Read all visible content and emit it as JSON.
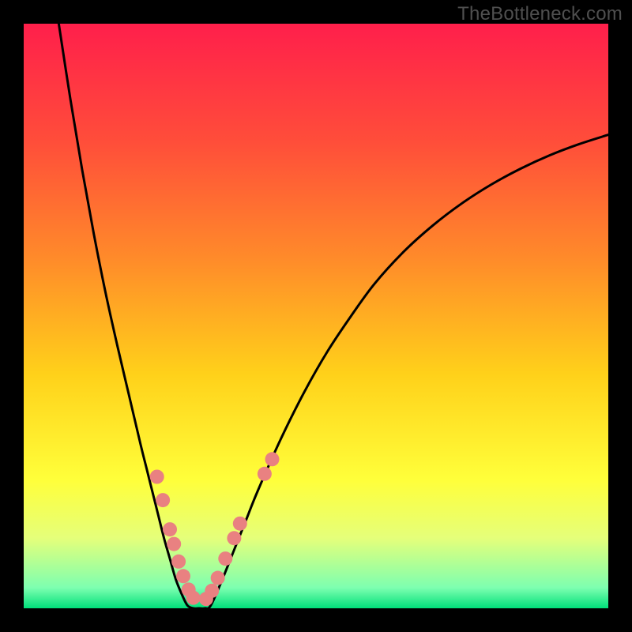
{
  "watermark": "TheBottleneck.com",
  "chart_data": {
    "type": "line",
    "title": "",
    "xlabel": "",
    "ylabel": "",
    "xlim": [
      0,
      100
    ],
    "ylim": [
      0,
      100
    ],
    "grid": false,
    "legend": false,
    "background_gradient_stops": [
      {
        "offset": 0.0,
        "color": "#ff1f4b"
      },
      {
        "offset": 0.2,
        "color": "#ff4d3a"
      },
      {
        "offset": 0.4,
        "color": "#ff8a2a"
      },
      {
        "offset": 0.6,
        "color": "#ffd11a"
      },
      {
        "offset": 0.78,
        "color": "#ffff3a"
      },
      {
        "offset": 0.88,
        "color": "#e5ff7a"
      },
      {
        "offset": 0.965,
        "color": "#7dffb0"
      },
      {
        "offset": 1.0,
        "color": "#00e07a"
      }
    ],
    "series": [
      {
        "name": "left-branch",
        "color": "#000000",
        "x": [
          6.0,
          8.0,
          10.0,
          12.0,
          14.0,
          16.0,
          18.0,
          20.0,
          21.0,
          22.0,
          23.0,
          24.0,
          25.0,
          26.0,
          27.0,
          28.0
        ],
        "y": [
          100.0,
          87.0,
          75.0,
          64.0,
          54.0,
          45.0,
          36.5,
          28.0,
          24.0,
          20.0,
          16.0,
          12.0,
          8.5,
          5.0,
          2.5,
          0.5
        ]
      },
      {
        "name": "valley-floor",
        "color": "#000000",
        "x": [
          28.0,
          29.0,
          30.0,
          31.0,
          32.0
        ],
        "y": [
          0.5,
          0.0,
          0.0,
          0.0,
          0.5
        ]
      },
      {
        "name": "right-branch",
        "color": "#000000",
        "x": [
          32.0,
          34.0,
          36.0,
          38.0,
          40.0,
          44.0,
          48.0,
          52.0,
          56.0,
          60.0,
          65.0,
          70.0,
          75.0,
          80.0,
          85.0,
          90.0,
          95.0,
          100.0
        ],
        "y": [
          0.5,
          5.0,
          10.0,
          15.0,
          20.0,
          29.0,
          37.0,
          44.0,
          50.0,
          55.5,
          61.0,
          65.5,
          69.3,
          72.5,
          75.2,
          77.5,
          79.4,
          81.0
        ]
      }
    ],
    "markers": {
      "name": "scatter-points",
      "color": "#e98181",
      "radius_css_px": 9,
      "points": [
        {
          "x": 22.8,
          "y": 22.5
        },
        {
          "x": 23.8,
          "y": 18.5
        },
        {
          "x": 25.0,
          "y": 13.5
        },
        {
          "x": 25.7,
          "y": 11.0
        },
        {
          "x": 26.5,
          "y": 8.0
        },
        {
          "x": 27.3,
          "y": 5.5
        },
        {
          "x": 28.2,
          "y": 3.2
        },
        {
          "x": 29.0,
          "y": 1.8
        },
        {
          "x": 31.2,
          "y": 1.6
        },
        {
          "x": 32.2,
          "y": 3.0
        },
        {
          "x": 33.2,
          "y": 5.2
        },
        {
          "x": 34.5,
          "y": 8.5
        },
        {
          "x": 36.0,
          "y": 12.0
        },
        {
          "x": 37.0,
          "y": 14.5
        },
        {
          "x": 41.2,
          "y": 23.0
        },
        {
          "x": 42.5,
          "y": 25.5
        }
      ]
    }
  }
}
